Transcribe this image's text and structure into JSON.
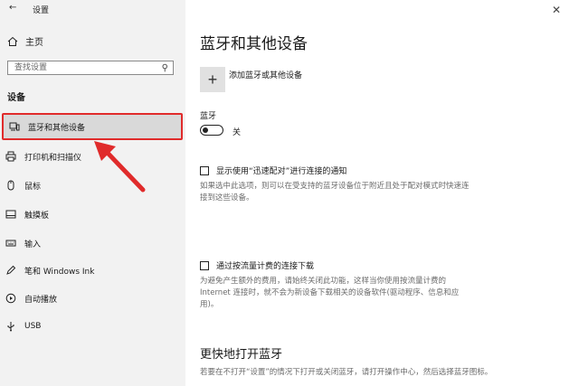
{
  "window": {
    "title": "设置"
  },
  "sidebar": {
    "home_label": "主页",
    "search_placeholder": "查找设置",
    "section": "设备",
    "items": [
      {
        "label": "蓝牙和其他设备",
        "icon": "devices-icon",
        "active": true
      },
      {
        "label": "打印机和扫描仪",
        "icon": "printer-icon"
      },
      {
        "label": "鼠标",
        "icon": "mouse-icon"
      },
      {
        "label": "触摸板",
        "icon": "touchpad-icon"
      },
      {
        "label": "输入",
        "icon": "keyboard-icon"
      },
      {
        "label": "笔和 Windows Ink",
        "icon": "pen-icon"
      },
      {
        "label": "自动播放",
        "icon": "autoplay-icon"
      },
      {
        "label": "USB",
        "icon": "usb-icon"
      }
    ]
  },
  "main": {
    "title": "蓝牙和其他设备",
    "add_device_label": "添加蓝牙或其他设备",
    "bluetooth_label": "蓝牙",
    "bluetooth_state": "关",
    "swift_pair": {
      "label": "显示使用“迅速配对”进行连接的通知",
      "desc": "如果选中此选项，则可以在受支持的蓝牙设备位于附近且处于配对模式时快速连接到这些设备。"
    },
    "metered": {
      "label": "通过按流量计费的连接下载",
      "desc": "为避免产生额外的费用，请始终关闭此功能，这样当你使用按流量计费的 Internet 连接时，就不会为新设备下载相关的设备软件(驱动程序、信息和应用)。"
    },
    "faster_title": "更快地打开蓝牙",
    "faster_desc": "若要在不打开“设置”的情况下打开或关闭蓝牙，请打开操作中心，然后选择蓝牙图标。"
  },
  "colors": {
    "highlight_border": "#e02b2b",
    "sidebar_bg": "#f2f2f2",
    "active_bg": "#d9d9d9"
  }
}
